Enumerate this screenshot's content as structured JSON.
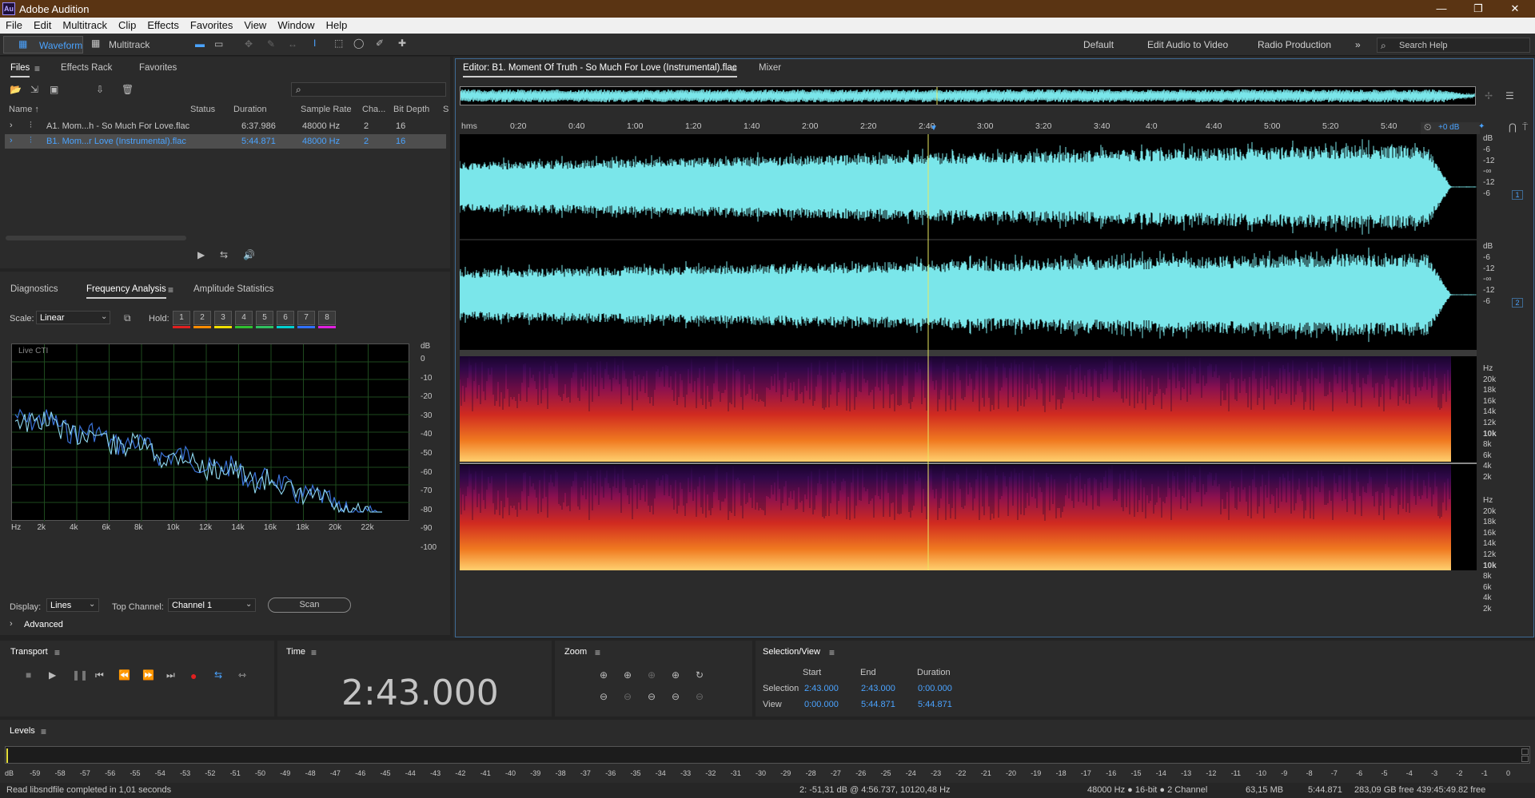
{
  "app": {
    "title": "Adobe Audition",
    "logo": "Au"
  },
  "menu": [
    "File",
    "Edit",
    "Multitrack",
    "Clip",
    "Effects",
    "Favorites",
    "View",
    "Window",
    "Help"
  ],
  "toolbar": {
    "waveform": "Waveform",
    "multitrack": "Multitrack",
    "workspaces": [
      "Default",
      "Edit Audio to Video",
      "Radio Production"
    ],
    "search_placeholder": "Search Help"
  },
  "files_panel": {
    "tabs": [
      "Files",
      "Effects Rack",
      "Favorites"
    ],
    "columns": [
      "Name ↑",
      "Status",
      "Duration",
      "Sample Rate",
      "Cha...",
      "Bit Depth",
      "S"
    ],
    "rows": [
      {
        "name": "A1. Mom...h - So Much For Love.flac",
        "status": "",
        "duration": "6:37.986",
        "rate": "48000 Hz",
        "ch": "2",
        "bits": "16"
      },
      {
        "name": "B1. Mom...r Love (Instrumental).flac",
        "status": "",
        "duration": "5:44.871",
        "rate": "48000 Hz",
        "ch": "2",
        "bits": "16"
      }
    ]
  },
  "analysis": {
    "tabs": [
      "Diagnostics",
      "Frequency Analysis",
      "Amplitude Statistics"
    ],
    "scale_label": "Scale:",
    "scale_value": "Linear",
    "hold_label": "Hold:",
    "holds": [
      "1",
      "2",
      "3",
      "4",
      "5",
      "6",
      "7",
      "8"
    ],
    "hold_colors": [
      "#e02020",
      "#ff8c00",
      "#f0e000",
      "#30c030",
      "#30c060",
      "#00d0d0",
      "#3070ff",
      "#e020e0"
    ],
    "graph_label": "Live CTI",
    "db_unit": "dB",
    "db_ticks": [
      "0",
      "-10",
      "-20",
      "-30",
      "-40",
      "-50",
      "-60",
      "-70",
      "-80",
      "-90",
      "-100"
    ],
    "hz_ticks": [
      "Hz",
      "2k",
      "4k",
      "6k",
      "8k",
      "10k",
      "12k",
      "14k",
      "16k",
      "18k",
      "20k",
      "22k"
    ],
    "display_label": "Display:",
    "display_value": "Lines",
    "top_channel_label": "Top Channel:",
    "top_channel_value": "Channel 1",
    "scan": "Scan",
    "advanced": "Advanced"
  },
  "editor": {
    "tab": "Editor: B1. Moment Of Truth - So Much For Love (Instrumental).flac",
    "mixer": "Mixer",
    "ruler": [
      "hms",
      "0:20",
      "0:40",
      "1:00",
      "1:20",
      "1:40",
      "2:00",
      "2:20",
      "2:40",
      "3:00",
      "3:20",
      "3:40",
      "4:0",
      "4:40",
      "5:00",
      "5:20",
      "5:40"
    ],
    "hud_gain": "+0 dB",
    "db_ticks": [
      "dB",
      "-6",
      "-12",
      "-∞",
      "-12",
      "-6"
    ],
    "ch1": "1",
    "ch2": "2",
    "hz_ticks_1": [
      "Hz",
      "20k",
      "18k",
      "16k",
      "14k",
      "12k",
      "10k",
      "8k",
      "6k",
      "4k",
      "2k"
    ],
    "hz_ticks_2": [
      "Hz",
      "20k",
      "18k",
      "16k",
      "14k",
      "12k",
      "10k",
      "8k",
      "6k",
      "4k",
      "2k"
    ],
    "waveform_color": "#7ae6ea",
    "playhead_color": "#e8e860"
  },
  "transport": {
    "label": "Transport"
  },
  "time": {
    "label": "Time",
    "value": "2:43.000"
  },
  "zoom": {
    "label": "Zoom"
  },
  "selection": {
    "label": "Selection/View",
    "cols": [
      "Start",
      "End",
      "Duration"
    ],
    "sel_label": "Selection",
    "sel": [
      "2:43.000",
      "2:43.000",
      "0:00.000"
    ],
    "view_label": "View",
    "view": [
      "0:00.000",
      "5:44.871",
      "5:44.871"
    ]
  },
  "levels": {
    "label": "Levels",
    "ticks": [
      "dB",
      "-59",
      "-58",
      "-57",
      "-56",
      "-55",
      "-54",
      "-53",
      "-52",
      "-51",
      "-50",
      "-49",
      "-48",
      "-47",
      "-46",
      "-45",
      "-44",
      "-43",
      "-42",
      "-41",
      "-40",
      "-39",
      "-38",
      "-37",
      "-36",
      "-35",
      "-34",
      "-33",
      "-32",
      "-31",
      "-30",
      "-29",
      "-28",
      "-27",
      "-26",
      "-25",
      "-24",
      "-23",
      "-22",
      "-21",
      "-20",
      "-19",
      "-18",
      "-17",
      "-16",
      "-15",
      "-14",
      "-13",
      "-12",
      "-11",
      "-10",
      "-9",
      "-8",
      "-7",
      "-6",
      "-5",
      "-4",
      "-3",
      "-2",
      "-1",
      "0"
    ]
  },
  "status": {
    "left": "Read libsndfile completed in 1,01 seconds",
    "cursor": "2: -51,31 dB @ 4:56.737, 10120,48 Hz",
    "format": "48000 Hz ● 16-bit ● 2 Channel",
    "size": "63,15 MB",
    "duration": "5:44.871",
    "free": "283,09 GB free",
    "free_time": "439:45:49.82 free"
  }
}
